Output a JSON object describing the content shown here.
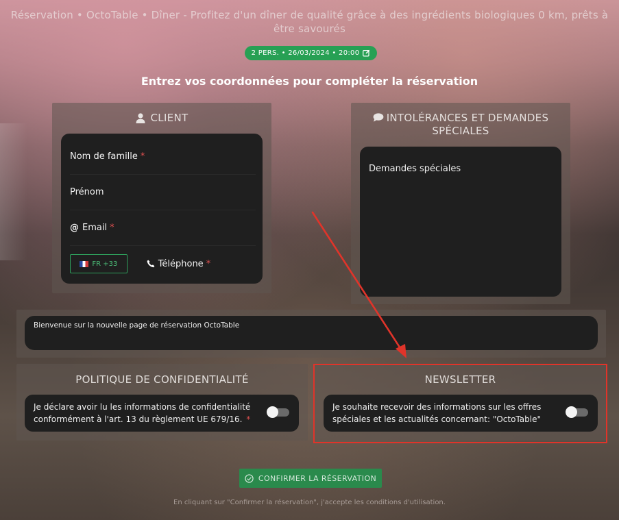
{
  "header": {
    "title": "Réservation • OctoTable • Dîner - Profitez d'un dîner de qualité grâce à des ingrédients biologiques 0 km, prêts à être savourés"
  },
  "booking_pill": {
    "text": "2 PERS. • 26/03/2024 • 20:00",
    "edit_icon": "edit-icon"
  },
  "subtitle": "Entrez vos coordonnées pour compléter la réservation",
  "client": {
    "title": "CLIENT",
    "icon": "user-icon",
    "fields": {
      "last_name": "Nom de famille",
      "first_name": "Prénom",
      "email": "Email",
      "phone": "Téléphone",
      "phone_prefix": "FR +33"
    },
    "required_marker": "*"
  },
  "intolerances": {
    "title": "INTOLÉRANCES ET DEMANDES SPÉCIALES",
    "icon": "chat-icon",
    "special_requests_placeholder": "Demandes spéciales"
  },
  "welcome_message": "Bienvenue sur la nouvelle page de réservation OctoTable",
  "privacy": {
    "title": "POLITIQUE DE CONFIDENTIALITÉ",
    "text": "Je déclare avoir lu les informations de confidentialité conformément à l'art. 13 du règlement UE 679/16.",
    "required_marker": "*",
    "toggle_on": false
  },
  "newsletter": {
    "title": "NEWSLETTER",
    "text": "Je souhaite recevoir des informations sur les offres spéciales et les actualités concernant: \"OctoTable\"",
    "toggle_on": false
  },
  "confirm_button": "CONFIRMER LA RÉSERVATION",
  "terms_note": "En cliquant sur \"Confirmer la réservation\", j'accepte les conditions d'utilisation.",
  "colors": {
    "accent_green": "#27a054",
    "required_red": "#e05050",
    "annotation_red": "#e0342a",
    "card_bg": "#1f1f1f"
  }
}
